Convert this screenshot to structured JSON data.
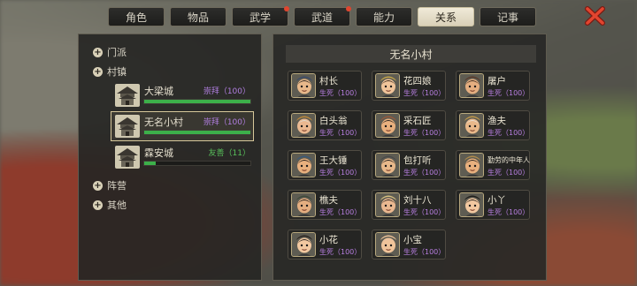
{
  "tabs": [
    {
      "label": "角色",
      "active": false,
      "dot": false
    },
    {
      "label": "物品",
      "active": false,
      "dot": false
    },
    {
      "label": "武学",
      "active": false,
      "dot": true
    },
    {
      "label": "武道",
      "active": false,
      "dot": true
    },
    {
      "label": "能力",
      "active": false,
      "dot": false
    },
    {
      "label": "关系",
      "active": true,
      "dot": false
    },
    {
      "label": "记事",
      "active": false,
      "dot": false
    }
  ],
  "tree": {
    "sect_label": "门派",
    "town_label": "村镇",
    "camp_label": "阵营",
    "other_label": "其他",
    "towns": [
      {
        "name": "大梁城",
        "relation": "崇拜（100）",
        "value": 100,
        "max": 100,
        "color": "#b07ee0"
      },
      {
        "name": "无名小村",
        "relation": "崇拜（100）",
        "value": 100,
        "max": 100,
        "color": "#b07ee0"
      },
      {
        "name": "霖安城",
        "relation": "友善（11）",
        "value": 11,
        "max": 100,
        "color": "#58c05a"
      }
    ]
  },
  "village": {
    "title": "无名小村",
    "npcs": [
      {
        "name": "村长",
        "relation": "生死（100）",
        "face": "#e8b88a",
        "hair": "#2a2520",
        "hat": "#3a4a6a"
      },
      {
        "name": "花四娘",
        "relation": "生死（100）",
        "face": "#f0c49a",
        "hair": "#3a2a1e",
        "hat": "#c8a84a"
      },
      {
        "name": "屠户",
        "relation": "生死（100）",
        "face": "#e4ae80",
        "hair": "#3a2a1e",
        "hat": "#5a3a2a"
      },
      {
        "name": "白头翁",
        "relation": "生死（100）",
        "face": "#eab890",
        "hair": "#dedad0",
        "hat": "#c08a3a"
      },
      {
        "name": "采石匠",
        "relation": "生死（100）",
        "face": "#e8b07e",
        "hair": "#2b2620",
        "hat": "#9a5a3a"
      },
      {
        "name": "渔夫",
        "relation": "生死（100）",
        "face": "#e8b88a",
        "hair": "#e6e0d6",
        "hat": "#c49a4a"
      },
      {
        "name": "王大锤",
        "relation": "生死（100）",
        "face": "#e8b07e",
        "hair": "#1e1c1a",
        "hat": "#3a5a7a"
      },
      {
        "name": "包打听",
        "relation": "生死（100）",
        "face": "#e8b88a",
        "hair": "#1e1c1a",
        "hat": "#4a4a4a"
      },
      {
        "name": "勤劳的中年人",
        "relation": "生死（100）",
        "face": "#e8b07e",
        "hair": "#2a2420",
        "hat": "#b08a4a"
      },
      {
        "name": "樵夫",
        "relation": "生死（100）",
        "face": "#e4ae80",
        "hair": "#1e1c1a",
        "hat": "#3e4a3a"
      },
      {
        "name": "刘十八",
        "relation": "生死（100）",
        "face": "#eab890",
        "hair": "#2a2520",
        "hat": "#d8c080"
      },
      {
        "name": "小丫",
        "relation": "生死（100）",
        "face": "#f2c8a0",
        "hair": "#1e1c1a",
        "hat": "#1e1c1a"
      },
      {
        "name": "小花",
        "relation": "生死（100）",
        "face": "#f2c8a0",
        "hair": "#2a2420",
        "hat": "#2a2420"
      },
      {
        "name": "小宝",
        "relation": "生死（100）",
        "face": "#f0c49a",
        "hair": "#e8c0a0",
        "hat": "#f0c49a"
      }
    ]
  }
}
